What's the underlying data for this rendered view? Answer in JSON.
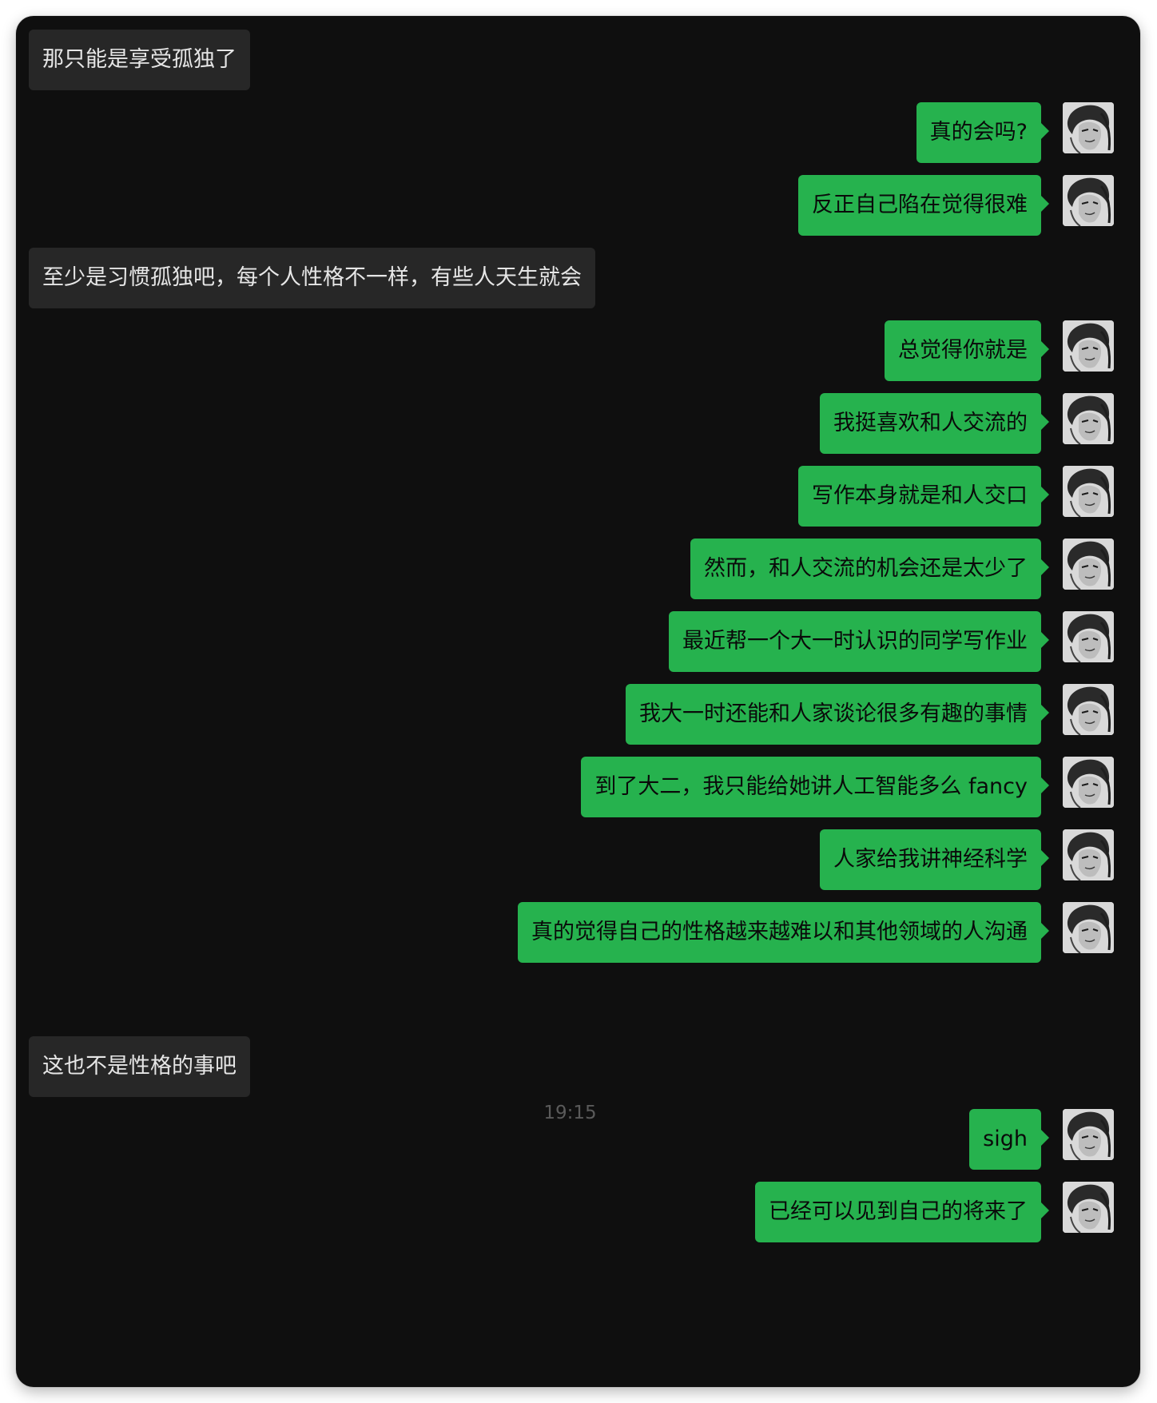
{
  "conversation": {
    "messages": [
      {
        "direction": "in",
        "text": "那只能是享受孤独了"
      },
      {
        "direction": "out",
        "text": "真的会吗?"
      },
      {
        "direction": "out",
        "text": "反正自己陷在觉得很难"
      },
      {
        "direction": "in",
        "text": "至少是习惯孤独吧，每个人性格不一样，有些人天生就会"
      },
      {
        "direction": "out",
        "text": "总觉得你就是"
      },
      {
        "direction": "out",
        "text": "我挺喜欢和人交流的"
      },
      {
        "direction": "out",
        "text": "写作本身就是和人交口"
      },
      {
        "direction": "out",
        "text": "然而，和人交流的机会还是太少了"
      },
      {
        "direction": "out",
        "text": "最近帮一个大一时认识的同学写作业"
      },
      {
        "direction": "out",
        "text": "我大一时还能和人家谈论很多有趣的事情"
      },
      {
        "direction": "out",
        "text": "到了大二，我只能给她讲人工智能多么 fancy"
      },
      {
        "direction": "out",
        "text": "人家给我讲神经科学"
      },
      {
        "direction": "out",
        "text": "真的觉得自己的性格越来越难以和其他领域的人沟通"
      },
      {
        "direction": "in",
        "text": "这也不是性格的事吧"
      },
      {
        "direction": "out",
        "text": "sigh"
      },
      {
        "direction": "out",
        "text": "已经可以见到自己的将来了"
      }
    ],
    "timestamp": "19:15",
    "avatar_icon": "user-avatar-icon",
    "colors": {
      "background": "#0f0f0f",
      "incoming_bubble": "#272727",
      "outgoing_bubble": "#26b24e"
    }
  }
}
